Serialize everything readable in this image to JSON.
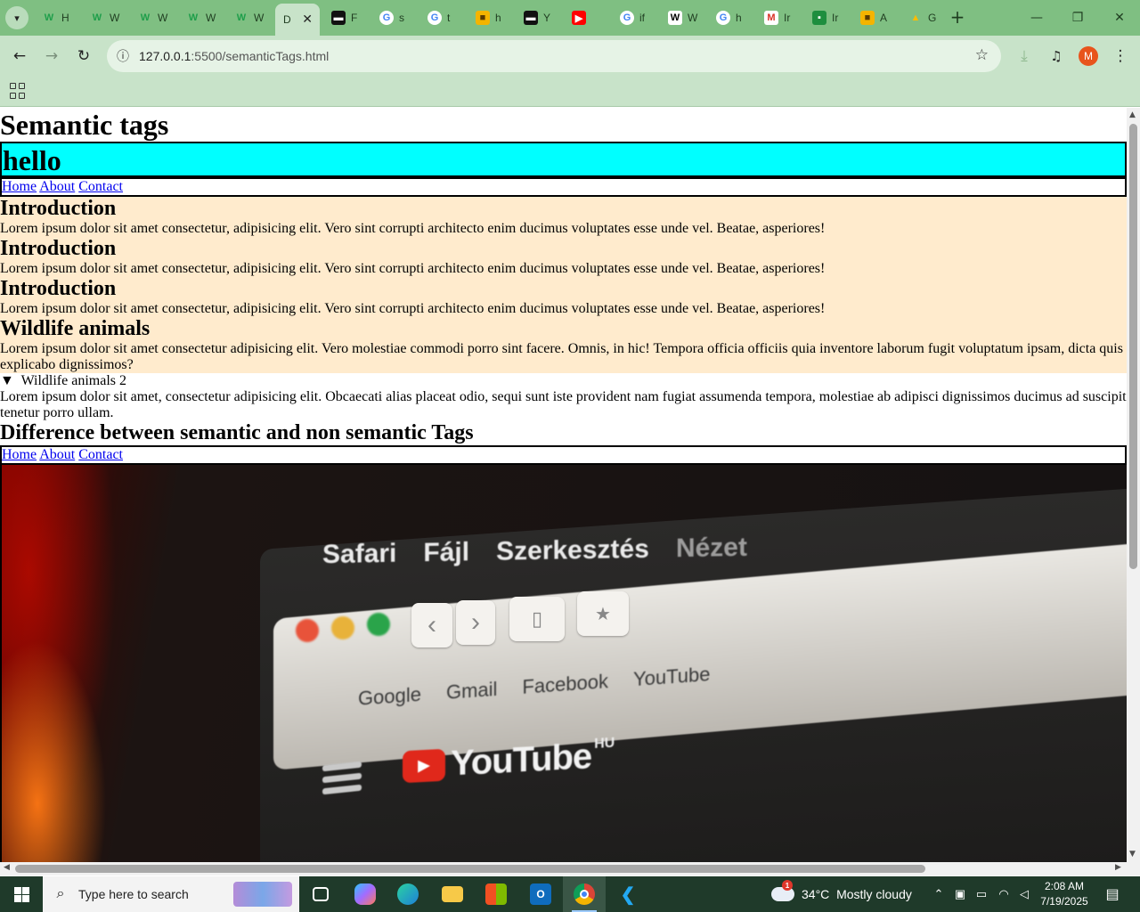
{
  "browser": {
    "tabs": [
      {
        "label": "H",
        "favicon": "w3schools-icon"
      },
      {
        "label": "W",
        "favicon": "w3schools-icon"
      },
      {
        "label": "W",
        "favicon": "w3schools-icon"
      },
      {
        "label": "W",
        "favicon": "w3schools-icon"
      },
      {
        "label": "W",
        "favicon": "w3schools-icon"
      },
      {
        "label": "D",
        "favicon": "none",
        "active": true
      },
      {
        "label": "F",
        "favicon": "dark-app-icon"
      },
      {
        "label": "s",
        "favicon": "google-icon"
      },
      {
        "label": "t",
        "favicon": "google-icon"
      },
      {
        "label": "h",
        "favicon": "yellow-app-icon"
      },
      {
        "label": "Y",
        "favicon": "dark-app-icon"
      },
      {
        "label": "",
        "favicon": "youtube-icon"
      },
      {
        "label": "if",
        "favicon": "google-icon"
      },
      {
        "label": "W",
        "favicon": "wikipedia-icon"
      },
      {
        "label": "h",
        "favicon": "google-icon"
      },
      {
        "label": "Ir",
        "favicon": "gmail-icon"
      },
      {
        "label": "Ir",
        "favicon": "classroom-icon"
      },
      {
        "label": "A",
        "favicon": "yellow-app-icon"
      },
      {
        "label": "G",
        "favicon": "drive-icon"
      }
    ],
    "url_host": "127.0.0.1",
    "url_rest": ":5500/semanticTags.html",
    "profile_initial": "M"
  },
  "page": {
    "title": "Semantic tags",
    "header_text": "hello",
    "nav_links": [
      "Home",
      "About",
      "Contact"
    ],
    "sections": [
      {
        "heading": "Introduction",
        "text": "Lorem ipsum dolor sit amet consectetur, adipisicing elit. Vero sint corrupti architecto enim ducimus voluptates esse unde vel. Beatae, asperiores!"
      },
      {
        "heading": "Introduction",
        "text": "Lorem ipsum dolor sit amet consectetur, adipisicing elit. Vero sint corrupti architecto enim ducimus voluptates esse unde vel. Beatae, asperiores!"
      },
      {
        "heading": "Introduction",
        "text": "Lorem ipsum dolor sit amet consectetur, adipisicing elit. Vero sint corrupti architecto enim ducimus voluptates esse unde vel. Beatae, asperiores!"
      },
      {
        "heading": "Wildlife animals",
        "text": "Lorem ipsum dolor sit amet consectetur adipisicing elit. Vero molestiae commodi porro sint facere. Omnis, in hic! Tempora officia officiis quia inventore laborum fugit voluptatum ipsam, dicta quis explicabo dignissimos?"
      }
    ],
    "details_summary": "Wildlife animals 2",
    "details_text": "Lorem ipsum dolor sit amet, consectetur adipisicing elit. Obcaecati alias placeat odio, sequi sunt iste provident nam fugiat assumenda tempora, molestiae ab adipisci dignissimos ducimus ad suscipit tenetur porro ullam.",
    "difference_heading": "Difference between semantic and non semantic Tags",
    "nav_links_2": [
      "Home",
      "About",
      "Contact"
    ],
    "hero_image": {
      "menubar": [
        "Safari",
        "Fájl",
        "Szerkesztés",
        "Nézet"
      ],
      "favorites": [
        "Google",
        "Gmail",
        "Facebook",
        "YouTube"
      ],
      "logo_word": "YouTube",
      "logo_region": "HU"
    }
  },
  "taskbar": {
    "search_placeholder": "Type here to search",
    "weather_temp": "34°C",
    "weather_desc": "Mostly cloudy",
    "weather_badge": "1",
    "time": "2:08 AM",
    "date": "7/19/2025"
  },
  "colors": {
    "tabstrip": "#7fbf82",
    "toolbar": "#c8e3c9",
    "header_bg": "#00ffff",
    "section_bg": "#ffebcd",
    "link": "#0000ee"
  }
}
